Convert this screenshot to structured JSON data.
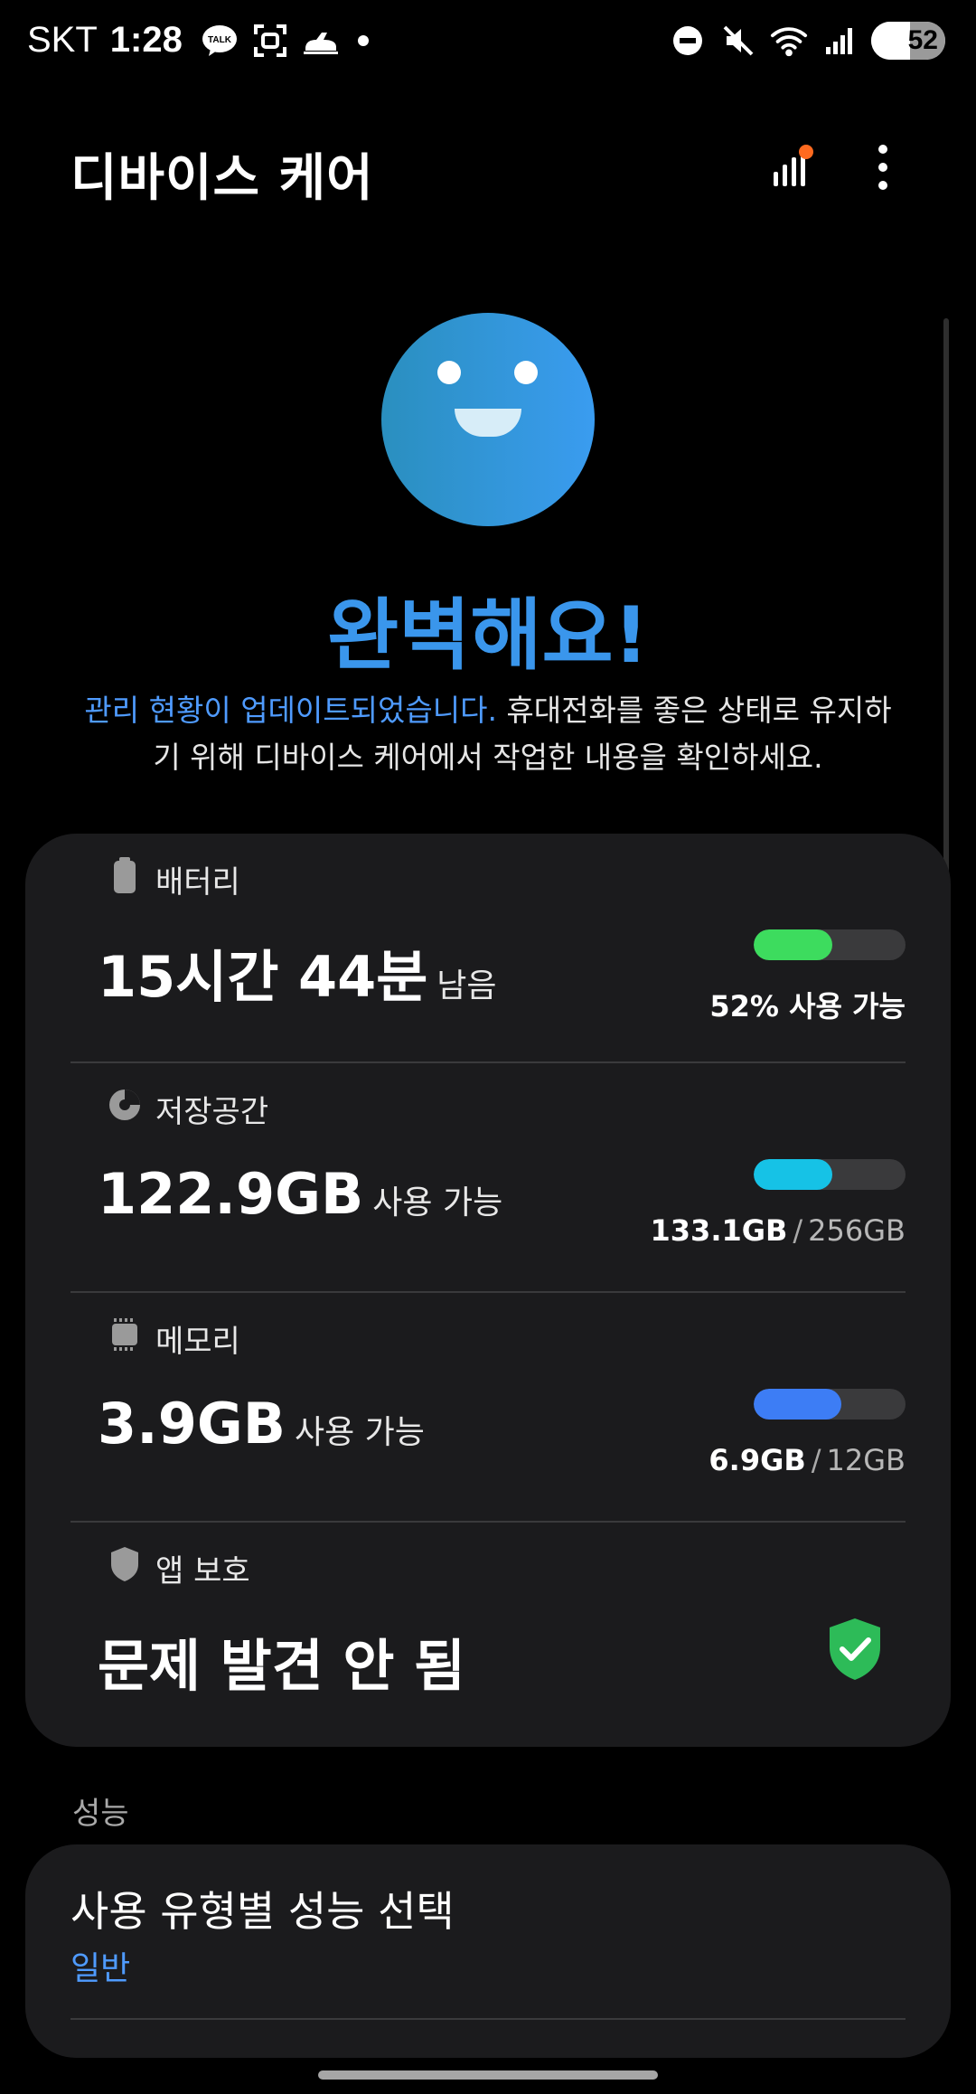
{
  "status_bar": {
    "carrier": "SKT",
    "time": "1:28",
    "talk_icon_text": "TALK",
    "battery_level": "52"
  },
  "header": {
    "title": "디바이스 케어"
  },
  "hero": {
    "title": "완벽해요!",
    "description_highlight": "관리 현황이 업데이트되었습니다.",
    "description_rest": " 휴대전화를 좋은 상태로 유지하기 위해 디바이스 케어에서 작업한 내용을 확인하세요."
  },
  "battery": {
    "label": "배터리",
    "value": "15시간 44분",
    "unit": "남음",
    "meta": "52% 사용 가능",
    "fill_fraction": 0.52,
    "color": "#3ddc5e"
  },
  "storage": {
    "label": "저장공간",
    "value": "122.9GB",
    "unit": "사용 가능",
    "used": "133.1GB",
    "separator": "/",
    "total": "256GB",
    "fill_fraction": 0.52,
    "color": "#16c2e6"
  },
  "memory": {
    "label": "메모리",
    "value": "3.9GB",
    "unit": "사용 가능",
    "used": "6.9GB",
    "separator": "/",
    "total": "12GB",
    "fill_fraction": 0.575,
    "color": "#3d7df5"
  },
  "app_protection": {
    "label": "앱 보호",
    "value": "문제 발견 안 됨",
    "color": "#2dbb58"
  },
  "performance": {
    "section_label": "성능",
    "title": "사용 유형별 성능 선택",
    "subtitle": "일반"
  },
  "colors": {
    "accent": "#4f9bff",
    "notification_dot": "#ff6a1f",
    "card_bg": "#1b1b1d"
  },
  "icons": [
    "talk-icon",
    "camera-scan-icon",
    "car-icon",
    "dnd-icon",
    "mute-icon",
    "wifi-icon",
    "signal-icon",
    "stats-icon",
    "more-icon",
    "battery-icon",
    "storage-icon",
    "memory-icon",
    "shield-icon",
    "shield-check-icon"
  ]
}
